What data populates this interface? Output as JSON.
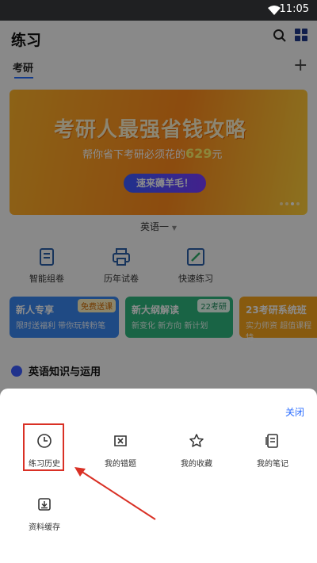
{
  "status_bar": {
    "time": "11:05"
  },
  "app": {
    "title": "练习",
    "tab_active": "考研",
    "banner": {
      "headline": "考研人最强省钱攻略",
      "sub_prefix": "帮你省下考研必须花的",
      "sub_amount": "629",
      "sub_suffix": "元",
      "cta": "速来薅羊毛！"
    },
    "subject_selector": "英语一",
    "tools": [
      {
        "label": "智能组卷",
        "icon": "smart-paper-icon"
      },
      {
        "label": "历年试卷",
        "icon": "printer-icon"
      },
      {
        "label": "快速练习",
        "icon": "pen-edit-icon"
      }
    ],
    "promos": [
      {
        "title": "新人专享",
        "sub": "限时送福利 带你玩转粉笔",
        "tag": "免费送课"
      },
      {
        "title": "新大纲解读",
        "sub": "新变化 新方向 新计划",
        "tag": "22考研"
      },
      {
        "title": "23考研系统班",
        "sub": "实力师资 超值课程 特",
        "tag": ""
      }
    ],
    "section_title": "英语知识与运用"
  },
  "sheet": {
    "close_label": "关闭",
    "items": [
      {
        "label": "练习历史",
        "icon": "clock-icon"
      },
      {
        "label": "我的错题",
        "icon": "wrong-questions-icon"
      },
      {
        "label": "我的收藏",
        "icon": "star-icon"
      },
      {
        "label": "我的笔记",
        "icon": "notes-icon"
      },
      {
        "label": "资料缓存",
        "icon": "download-icon"
      }
    ]
  },
  "colors": {
    "accent": "#2a6cff",
    "highlight": "#d93025",
    "banner_orange": "#ff8a1c"
  }
}
